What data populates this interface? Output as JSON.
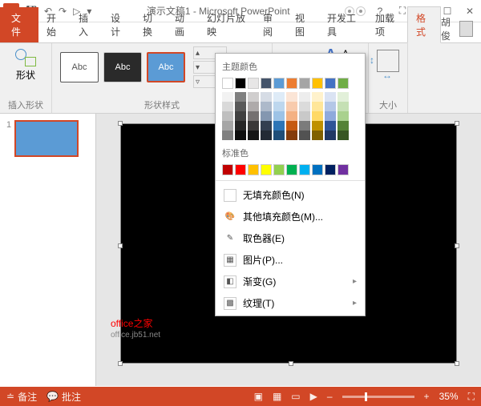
{
  "title": "演示文稿1 - Microsoft PowerPoint",
  "qat": {
    "save": "💾",
    "undo": "↶",
    "redo": "↷",
    "start": "▷",
    "more": "▾"
  },
  "win": {
    "help": "?",
    "full": "⛶",
    "min": "—",
    "max": "☐",
    "close": "✕"
  },
  "tabs": {
    "file": "文件",
    "home": "开始",
    "insert": "插入",
    "design": "设计",
    "transition": "切换",
    "anim": "动画",
    "slideshow": "幻灯片放映",
    "review": "审阅",
    "view": "视图",
    "dev": "开发工具",
    "addin": "加载项",
    "format": "格式"
  },
  "user": {
    "name": "胡俊"
  },
  "ribbon": {
    "shapes_label": "形状",
    "insert_shape": "插入形状",
    "abc": "Abc",
    "styles_label": "形状样式",
    "size_label": "大小"
  },
  "dropdown": {
    "theme_title": "主题颜色",
    "theme_row": [
      "#ffffff",
      "#000000",
      "#e7e6e6",
      "#44546a",
      "#5b9bd5",
      "#ed7d31",
      "#a5a5a5",
      "#ffc000",
      "#4472c4",
      "#70ad47"
    ],
    "shades": [
      [
        "#f2f2f2",
        "#d9d9d9",
        "#bfbfbf",
        "#a6a6a6",
        "#808080"
      ],
      [
        "#808080",
        "#595959",
        "#404040",
        "#262626",
        "#0d0d0d"
      ],
      [
        "#d0cece",
        "#aeaaaa",
        "#757171",
        "#3a3838",
        "#161616"
      ],
      [
        "#d6dce5",
        "#adb9ca",
        "#8497b0",
        "#333f50",
        "#222a35"
      ],
      [
        "#deebf7",
        "#bdd7ee",
        "#9dc3e6",
        "#2e75b6",
        "#1f4e79"
      ],
      [
        "#fbe5d6",
        "#f8cbad",
        "#f4b183",
        "#c55a11",
        "#843c0c"
      ],
      [
        "#ededed",
        "#dbdbdb",
        "#c9c9c9",
        "#7b7b7b",
        "#525252"
      ],
      [
        "#fff2cc",
        "#ffe699",
        "#ffd966",
        "#bf9000",
        "#806000"
      ],
      [
        "#dae3f3",
        "#b4c7e7",
        "#8faadc",
        "#2f5597",
        "#203864"
      ],
      [
        "#e2f0d9",
        "#c5e0b4",
        "#a9d18e",
        "#548235",
        "#385723"
      ]
    ],
    "standard_title": "标准色",
    "standard": [
      "#c00000",
      "#ff0000",
      "#ffc000",
      "#ffff00",
      "#92d050",
      "#00b050",
      "#00b0f0",
      "#0070c0",
      "#002060",
      "#7030a0"
    ],
    "nofill": "无填充颜色(N)",
    "more": "其他填充颜色(M)...",
    "eyedrop": "取色器(E)",
    "picture": "图片(P)...",
    "gradient": "渐变(G)",
    "texture": "纹理(T)"
  },
  "thumbs": {
    "n1": "1"
  },
  "watermark": {
    "t": "office之家",
    "s": "office.jb51.net"
  },
  "status": {
    "notes": "备注",
    "comments": "批注",
    "zoom": "35%",
    "minus": "–",
    "plus": "+"
  }
}
